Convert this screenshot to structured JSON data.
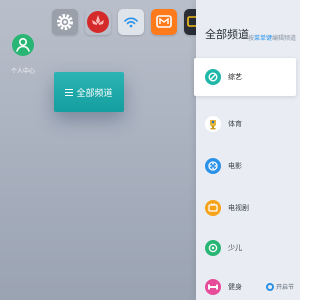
{
  "home": {
    "user_center_label": "个人中心",
    "all_channels_button": "全部频道"
  },
  "apps": [
    {
      "name": "settings-app"
    },
    {
      "name": "huawei-app"
    },
    {
      "name": "wifi-app"
    },
    {
      "name": "mango-tv-app"
    },
    {
      "name": "tv-app"
    }
  ],
  "panel": {
    "title": "全部频道",
    "hint_prefix": "按",
    "hint_key": "菜单键",
    "hint_suffix": "编辑频道",
    "bottom_hint": "开启节",
    "channels": [
      {
        "label": "综艺",
        "icon": "variety-icon",
        "color": "#1fb8a8",
        "active": true
      },
      {
        "label": "体育",
        "icon": "sports-icon",
        "color": "#ffffff",
        "active": false
      },
      {
        "label": "电影",
        "icon": "movie-icon",
        "color": "#2a91e8",
        "active": false
      },
      {
        "label": "电视剧",
        "icon": "tv-drama-icon",
        "color": "#f6a21a",
        "active": false
      },
      {
        "label": "少儿",
        "icon": "kids-icon",
        "color": "#29b573",
        "active": false
      },
      {
        "label": "健身",
        "icon": "fitness-icon",
        "color": "#e64c9a",
        "active": false
      }
    ]
  },
  "colors": {
    "accent_teal": "#159e9f",
    "panel_bg": "#e9edf3",
    "hint_blue": "#2a91e8"
  }
}
